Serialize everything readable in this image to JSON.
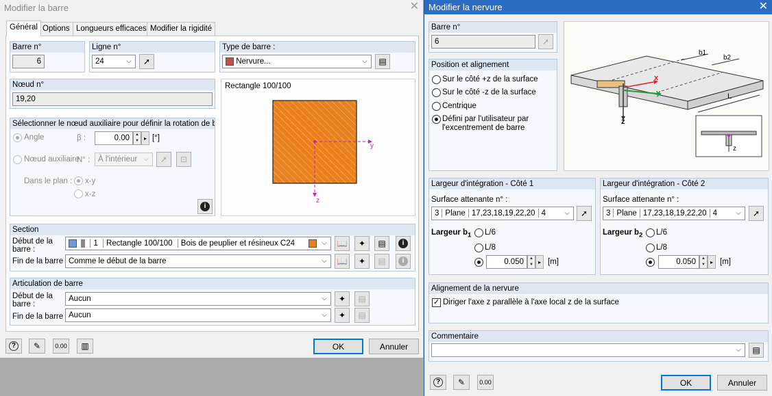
{
  "left": {
    "title": "Modifier la barre",
    "tabs": [
      "Général",
      "Options",
      "Longueurs efficaces",
      "Modifier la rigidité"
    ],
    "barre": {
      "label": "Barre n°",
      "value": "6"
    },
    "ligne": {
      "label": "Ligne n°",
      "value": "24"
    },
    "type": {
      "label": "Type de barre :",
      "value": "Nervure..."
    },
    "noeud": {
      "label": "Nœud n°",
      "value": "19,20"
    },
    "aux": {
      "header": "Sélectionner le nœud auxiliaire pour définir la rotation de barr",
      "angle_label": "Angle",
      "beta_label": "β :",
      "beta_value": "0.00",
      "beta_unit": "[°]",
      "aux_label": "Nœud auxiliaire",
      "n_label": "N° :",
      "n_value": "À l'intérieur",
      "plane_label": "Dans le plan :",
      "xy": "x-y",
      "xz": "x-z"
    },
    "preview": {
      "title": "Rectangle 100/100",
      "axis_y": "y",
      "axis_z": "z"
    },
    "section": {
      "header": "Section",
      "start_label": "Début de la barre :",
      "start_num": "1",
      "start_name": "Rectangle 100/100",
      "start_mat": "Bois de peuplier et résineux C24",
      "end_label": "Fin de la barre :",
      "end_value": "Comme le début de la barre"
    },
    "artic": {
      "header": "Articulation de barre",
      "start_label": "Début de la barre :",
      "start_value": "Aucun",
      "end_label": "Fin de la barre :",
      "end_value": "Aucun"
    },
    "ok": "OK",
    "cancel": "Annuler"
  },
  "right": {
    "title": "Modifier la nervure",
    "barre": {
      "label": "Barre n°",
      "value": "6"
    },
    "position": {
      "header": "Position et alignement",
      "opt1": "Sur le côté +z de la surface",
      "opt2": "Sur le côté -z de la surface",
      "opt3": "Centrique",
      "opt4a": "Défini par l'utilisateur par",
      "opt4b": "l'excentrement de barre"
    },
    "diagram": {
      "b1": "b1",
      "b2": "b2",
      "L": "L",
      "x": "x",
      "y": "y",
      "z": "z",
      "z2": "z"
    },
    "side1": {
      "header": "Largeur d'intégration - Côté 1",
      "surf_label": "Surface attenante n° :",
      "surf_num": "3",
      "surf_type": "Plane",
      "surf_lines": "17,23,18,19,22,20",
      "surf_extra": "4",
      "width_label": "Largeur b",
      "width_sub": "1",
      "l6": "L/6",
      "l8": "L/8",
      "value": "0.050",
      "unit": "[m]"
    },
    "side2": {
      "header": "Largeur d'intégration - Côté 2",
      "surf_label": "Surface attenante n° :",
      "surf_num": "3",
      "surf_type": "Plane",
      "surf_lines": "17,23,18,19,22,20",
      "surf_extra": "4",
      "width_label": "Largeur b",
      "width_sub": "2",
      "l6": "L/6",
      "l8": "L/8",
      "value": "0.050",
      "unit": "[m]"
    },
    "align": {
      "header": "Alignement de la nervure",
      "check_label": "Diriger l'axe z parallèle à l'axe local z de la surface"
    },
    "comment": {
      "header": "Commentaire",
      "value": ""
    },
    "ok": "OK",
    "cancel": "Annuler"
  },
  "colors": {
    "accent": "#0078d7",
    "section_fill": "#e8801e",
    "group_header": "#dde6f1",
    "red_swatch": "#c0504d",
    "blue_swatch": "#6b9bd8"
  }
}
